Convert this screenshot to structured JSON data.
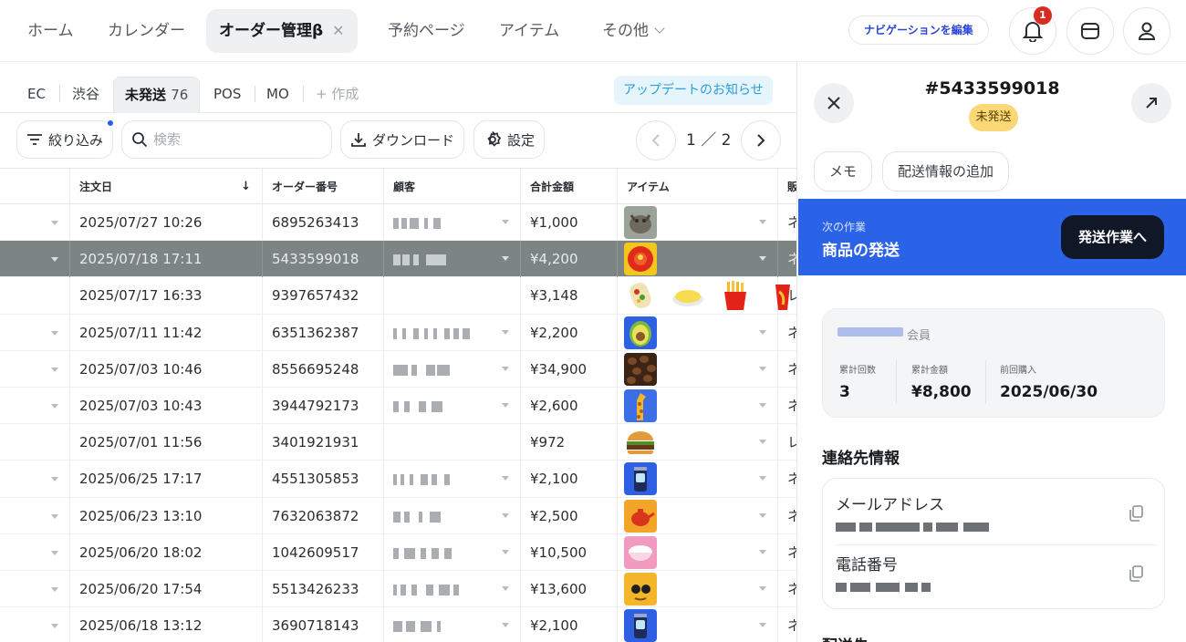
{
  "nav": {
    "items": [
      {
        "label": "ホーム"
      },
      {
        "label": "カレンダー"
      },
      {
        "label": "オーダー管理β",
        "active": true
      },
      {
        "label": "予約ページ"
      },
      {
        "label": "アイテム"
      },
      {
        "label": "その他"
      }
    ],
    "close_glyph": "✕",
    "edit_label": "ナビゲーションを編集",
    "notification_count": "1"
  },
  "subtabs": {
    "items": [
      {
        "label": "EC"
      },
      {
        "label": "渋谷"
      },
      {
        "label": "未発送",
        "count": "76",
        "active": true
      },
      {
        "label": "POS"
      },
      {
        "label": "MO"
      }
    ],
    "create_label": "+ 作成",
    "update_notice": "アップデートのお知らせ"
  },
  "toolbar": {
    "filter_label": "絞り込み",
    "search_placeholder": "検索",
    "download_label": "ダウンロード",
    "settings_label": "設定",
    "page_current": "1",
    "page_total": "2",
    "page_sep": "／"
  },
  "table": {
    "headers": {
      "date": "注文日",
      "order_no": "オーダー番号",
      "customer": "顧客",
      "total": "合計金額",
      "items": "アイテム",
      "channel": "販"
    },
    "sort_indicator": "↓",
    "rows": [
      {
        "date": "2025/07/27 10:26",
        "order_no": "6895263413",
        "total": "¥1,000",
        "channel": "ネ",
        "thumbs": [
          "cat"
        ],
        "customer_blurred": true,
        "expandable": true
      },
      {
        "date": "2025/07/18 17:11",
        "order_no": "5433599018",
        "total": "¥4,200",
        "channel": "ネ",
        "thumbs": [
          "red-plate"
        ],
        "customer_blurred": true,
        "expandable": true,
        "selected": true
      },
      {
        "date": "2025/07/17 16:33",
        "order_no": "9397657432",
        "total": "¥3,148",
        "channel": "レ",
        "thumbs": [
          "burrito",
          "omelette",
          "fries",
          "drink"
        ],
        "customer_blurred": false,
        "expandable": false
      },
      {
        "date": "2025/07/11 11:42",
        "order_no": "6351362387",
        "total": "¥2,200",
        "channel": "ネ",
        "thumbs": [
          "avocado"
        ],
        "customer_blurred": true,
        "expandable": true
      },
      {
        "date": "2025/07/03 10:46",
        "order_no": "8556695248",
        "total": "¥34,900",
        "channel": "ネ",
        "thumbs": [
          "coffee"
        ],
        "customer_blurred": true,
        "expandable": true
      },
      {
        "date": "2025/07/03 10:43",
        "order_no": "3944792173",
        "total": "¥2,600",
        "channel": "ネ",
        "thumbs": [
          "giraffe"
        ],
        "customer_blurred": true,
        "expandable": true
      },
      {
        "date": "2025/07/01 11:56",
        "order_no": "3401921931",
        "total": "¥972",
        "channel": "レ",
        "thumbs": [
          "burger"
        ],
        "customer_blurred": false,
        "expandable": false
      },
      {
        "date": "2025/06/25 17:17",
        "order_no": "4551305853",
        "total": "¥2,100",
        "channel": "ネ",
        "thumbs": [
          "can"
        ],
        "customer_blurred": true,
        "expandable": true
      },
      {
        "date": "2025/06/23 13:10",
        "order_no": "7632063872",
        "total": "¥2,500",
        "channel": "ネ",
        "thumbs": [
          "teapot"
        ],
        "customer_blurred": true,
        "expandable": true
      },
      {
        "date": "2025/06/20 18:02",
        "order_no": "1042609517",
        "total": "¥10,500",
        "channel": "ネ",
        "thumbs": [
          "bowl"
        ],
        "customer_blurred": true,
        "expandable": true
      },
      {
        "date": "2025/06/20 17:54",
        "order_no": "5513426233",
        "total": "¥13,600",
        "channel": "ネ",
        "thumbs": [
          "face"
        ],
        "customer_blurred": true,
        "expandable": true
      },
      {
        "date": "2025/06/18 13:12",
        "order_no": "3690718143",
        "total": "¥2,100",
        "channel": "ネ",
        "thumbs": [
          "can"
        ],
        "customer_blurred": true,
        "expandable": true
      }
    ]
  },
  "detail": {
    "order_number": "#5433599018",
    "status": "未発送",
    "memo_label": "メモ",
    "add_shipping_label": "配送情報の追加",
    "next_action_label": "次の作業",
    "next_action_title": "商品の発送",
    "ship_button_label": "発送作業へ",
    "member_label": "会員",
    "stats": [
      {
        "label": "累計回数",
        "value": "3"
      },
      {
        "label": "累計金額",
        "value": "¥8,800"
      },
      {
        "label": "前回購入",
        "value": "2025/06/30"
      }
    ],
    "contact_title": "連絡先情報",
    "email_label": "メールアドレス",
    "phone_label": "電話番号",
    "next_section_title": "配送先"
  },
  "colors": {
    "accent_blue": "#2b63e8",
    "status_yellow": "#fbd776",
    "selected_row": "#7c8484",
    "badge_red": "#d92b1f"
  }
}
